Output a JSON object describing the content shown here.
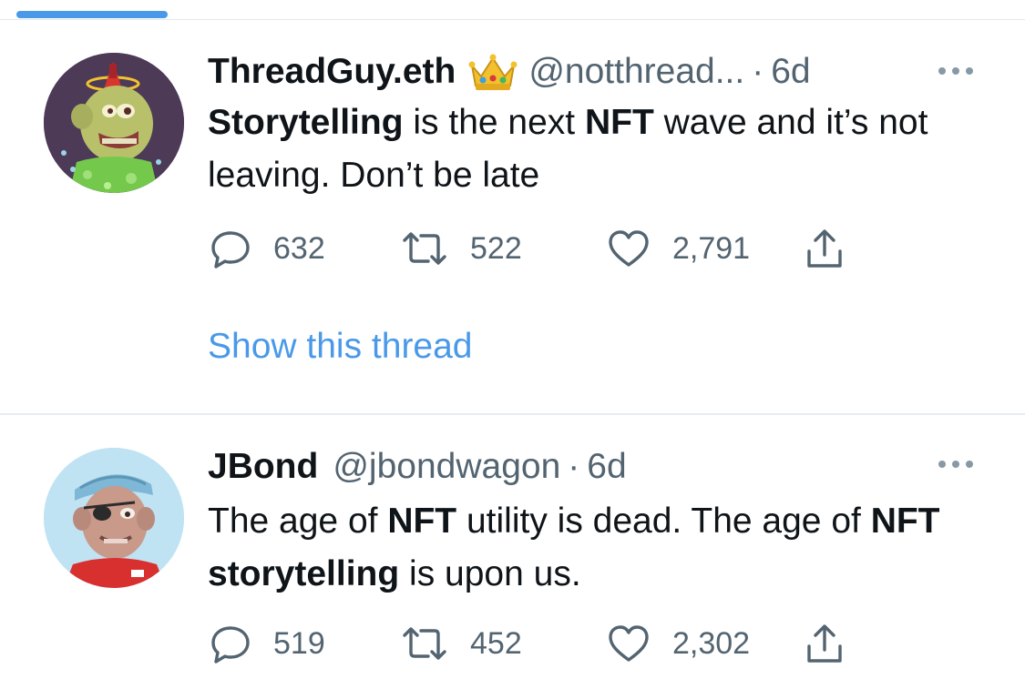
{
  "colors": {
    "accent": "#4a99e9",
    "text_primary": "#0f1419",
    "text_secondary": "#536471",
    "divider": "#e6ecf0"
  },
  "tweets": [
    {
      "display_name": "ThreadGuy.eth",
      "badge_icon": "crown-emoji",
      "handle": "@notthread...",
      "separator": "·",
      "time": "6d",
      "more_icon": "more-horizontal-icon",
      "body": [
        {
          "text": "Storytelling",
          "bold": true
        },
        {
          "text": " is the next ",
          "bold": false
        },
        {
          "text": "NFT",
          "bold": true
        },
        {
          "text": " wave and it’s not leaving. Don’t be late",
          "bold": false
        }
      ],
      "replies": "632",
      "retweets": "522",
      "likes": "2,791",
      "show_thread": "Show this thread"
    },
    {
      "display_name": "JBond",
      "handle": "@jbondwagon",
      "separator": "·",
      "time": "6d",
      "more_icon": "more-horizontal-icon",
      "body": [
        {
          "text": "The age of ",
          "bold": false
        },
        {
          "text": "NFT",
          "bold": true
        },
        {
          "text": " utility is dead. The age of ",
          "bold": false
        },
        {
          "text": "NFT storytelling",
          "bold": true
        },
        {
          "text": " is upon us.",
          "bold": false
        }
      ],
      "replies": "519",
      "retweets": "452",
      "likes": "2,302"
    }
  ]
}
